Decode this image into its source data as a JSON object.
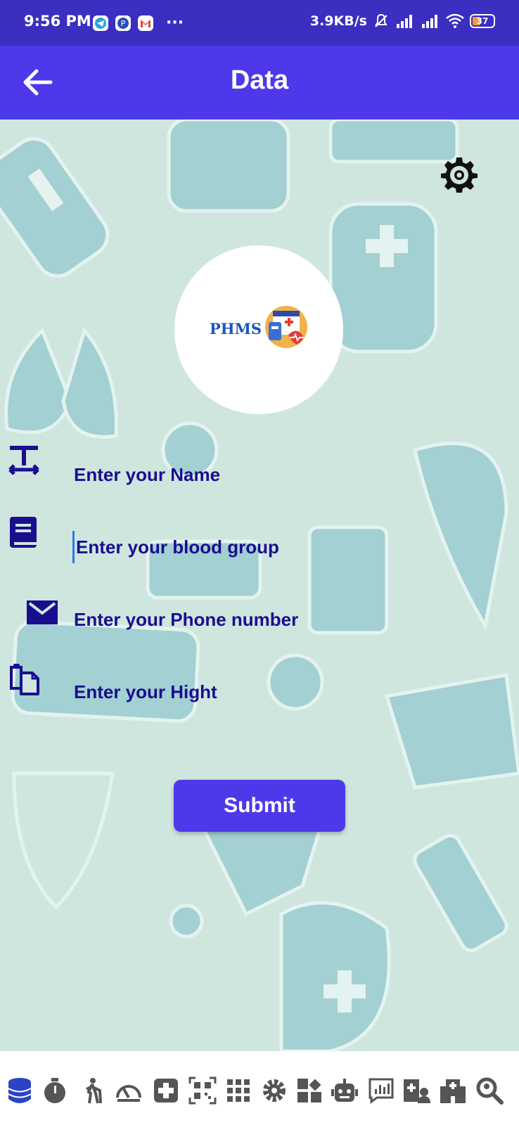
{
  "status_bar": {
    "time": "9:56 PM",
    "more": "···",
    "network_speed": "3.9KB/s",
    "battery": "37",
    "icons": [
      "telegram-icon",
      "pinterest-icon",
      "gmail-icon",
      "mute-icon",
      "signal-icon",
      "signal-icon",
      "wifi-icon",
      "battery-icon"
    ]
  },
  "app_bar": {
    "title": "Data",
    "back_icon": "arrow-left-icon"
  },
  "logo": {
    "text": "PHMS"
  },
  "form": {
    "fields": [
      {
        "placeholder": "Enter your Name",
        "icon": "text-format-icon"
      },
      {
        "placeholder": "Enter your blood group",
        "icon": "book-icon"
      },
      {
        "placeholder": "Enter your Phone number",
        "icon": "mail-icon"
      },
      {
        "placeholder": "Enter your Hight",
        "icon": "clipboard-icon"
      }
    ],
    "submit_label": "Submit"
  },
  "bottom_nav": {
    "icons": [
      "database-icon",
      "timer-icon",
      "walking-icon",
      "gauge-icon",
      "first-aid-icon",
      "qr-code-icon",
      "grid-icon",
      "gear-icon",
      "widgets-icon",
      "robot-icon",
      "chart-message-icon",
      "doctor-icon",
      "hospital-icon",
      "search-location-icon"
    ]
  },
  "colors": {
    "primary": "#4e39ea",
    "status_bar": "#3a2fc0",
    "text": "#1a0e8f",
    "background": "#cfe6df"
  }
}
